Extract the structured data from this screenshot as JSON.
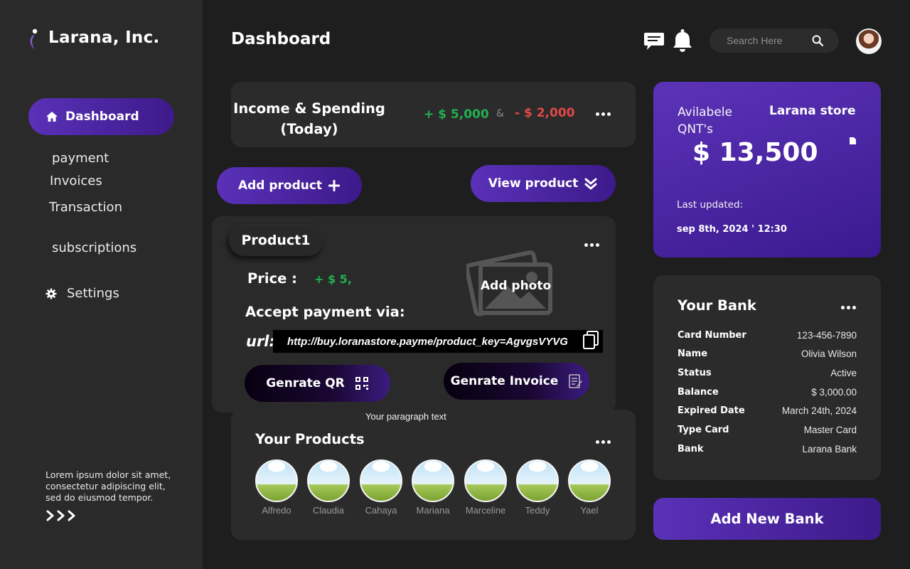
{
  "brand": {
    "name": "Larana, Inc.",
    "accent": "#5a31b8",
    "accent_dark": "#3d1a8a"
  },
  "sidebar": {
    "active_item": {
      "label": "Dashboard",
      "icon": "home-icon"
    },
    "items": [
      {
        "label": "payment"
      },
      {
        "label": "Invoices"
      },
      {
        "label": "Transaction"
      },
      {
        "label": "subscriptions"
      }
    ],
    "settings": {
      "label": "Settings",
      "icon": "gear-icon"
    },
    "note": "Lorem ipsum dolor sit amet, consectetur adipiscing elit, sed do eiusmod tempor."
  },
  "header": {
    "title": "Dashboard",
    "search_placeholder": "Search Here",
    "icons": [
      "chat-icon",
      "bell-icon",
      "search-icon"
    ]
  },
  "income": {
    "title": "Income & Spending (Today)",
    "income_value": "+ $ 5,000",
    "separator": "&",
    "spending_value": "- $ 2,000",
    "income_color": "#22b04f",
    "spending_color": "#e24848"
  },
  "actions": {
    "add_product": "Add product",
    "view_product": "View product"
  },
  "product": {
    "name": "Product1",
    "price_label": "Price :",
    "price_value": "+ $ 5,",
    "accept_label": "Accept payment via:",
    "url_label": "url:",
    "url_value": "http://buy.loranastore.payme/product_key=AgvgsVYVG",
    "add_photo": "Add photo",
    "generate_qr": "Genrate QR",
    "generate_invoice": "Genrate Invoice"
  },
  "paragraph": "Your paragraph text",
  "products": {
    "title": "Your Products",
    "people": [
      "Alfredo",
      "Claudia",
      "Cahaya",
      "Mariana",
      "Marceline",
      "Teddy",
      "Yael"
    ]
  },
  "balance": {
    "qnt_label": "Avilabele QNT's",
    "store": "Larana store",
    "value": "$ 13,500",
    "updated_label": "Last updated:",
    "updated_value": "sep 8th, 2024 ' 12:30"
  },
  "bank": {
    "title": "Your Bank",
    "rows": [
      {
        "key": "Card Number",
        "value": "123-456-7890"
      },
      {
        "key": "Name",
        "value": "Olivia Wilson"
      },
      {
        "key": "Status",
        "value": "Active"
      },
      {
        "key": "Balance",
        "value": "$ 3,000.00"
      },
      {
        "key": "Expired Date",
        "value": "March 24th, 2024"
      },
      {
        "key": "Type Card",
        "value": "Master Card"
      },
      {
        "key": "Bank",
        "value": "Larana Bank"
      }
    ],
    "add_button": "Add New Bank"
  }
}
